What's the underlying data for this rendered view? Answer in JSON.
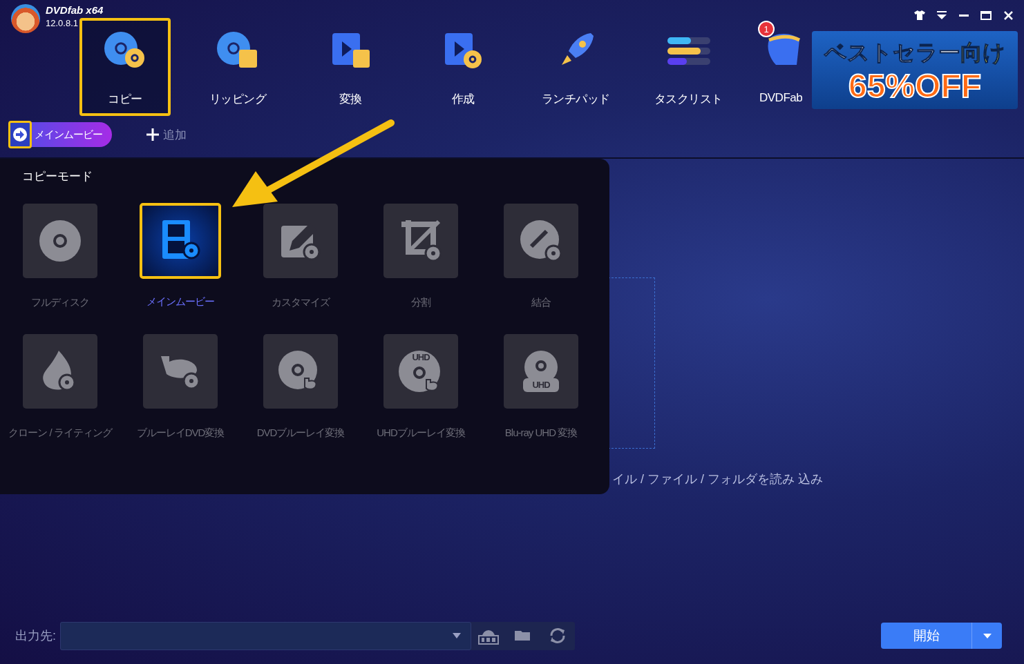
{
  "app": {
    "name": "DVDfab x64",
    "version": "12.0.8.1"
  },
  "nav": [
    {
      "label": "コピー",
      "kind": "copy",
      "selected": true
    },
    {
      "label": "リッピング",
      "kind": "rip",
      "selected": false
    },
    {
      "label": "変換",
      "kind": "convert",
      "selected": false
    },
    {
      "label": "作成",
      "kind": "create",
      "selected": false
    },
    {
      "label": "ランチパッド",
      "kind": "launch",
      "selected": false
    },
    {
      "label": "タスクリスト",
      "kind": "tasks",
      "selected": false
    },
    {
      "label": "DVDFab",
      "kind": "store",
      "selected": false,
      "badge": "1"
    }
  ],
  "promo": {
    "line_1": "ベストセラー",
    "line_1_highlight": "向け",
    "line_2": "65%OFF"
  },
  "mode_pill": {
    "label": "メインムービー"
  },
  "add_button": {
    "label": "追加"
  },
  "copy_mode_panel": {
    "title": "コピーモード",
    "modes": [
      {
        "label": "フルディスク",
        "kind": "disc",
        "selected": false
      },
      {
        "label": "メインムービー",
        "kind": "movie",
        "selected": true
      },
      {
        "label": "カスタマイズ",
        "kind": "edit",
        "selected": false
      },
      {
        "label": "分割",
        "kind": "split",
        "selected": false
      },
      {
        "label": "結合",
        "kind": "merge",
        "selected": false
      },
      {
        "label": "クローン / ライティング",
        "kind": "clone",
        "selected": false
      },
      {
        "label": "ブルーレイDVD変換",
        "kind": "bd",
        "selected": false
      },
      {
        "label": "DVDブルーレイ変換",
        "kind": "dvdbd",
        "selected": false
      },
      {
        "label": "UHDブルーレイ変換",
        "kind": "uhdtop",
        "selected": false,
        "icon_text": "UHD"
      },
      {
        "label": "Blu-ray UHD 変換",
        "kind": "uhdbottom",
        "selected": false,
        "icon_text": "UHD"
      }
    ]
  },
  "drop_hint": "イル / ファイル / フォルダを読み 込み",
  "output": {
    "label": "出力先:"
  },
  "start_button": {
    "label": "開始"
  }
}
